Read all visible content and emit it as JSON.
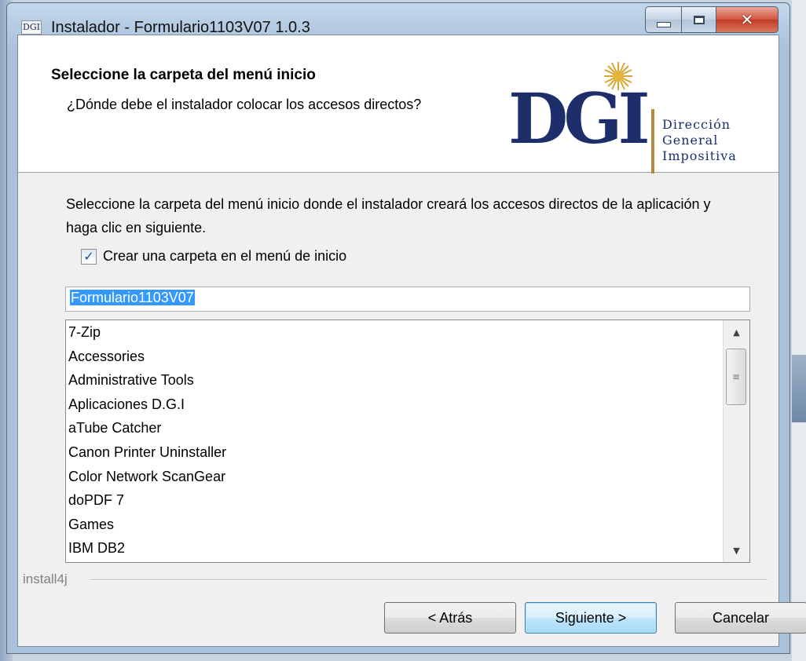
{
  "window": {
    "title": "Instalador - Formulario1103V07 1.0.3",
    "icon_text": "DGI"
  },
  "header": {
    "title": "Seleccione la carpeta del menú inicio",
    "subtitle": "¿Dónde debe el instalador colocar los accesos directos?"
  },
  "logo": {
    "mark": "DGI",
    "line1": "Dirección",
    "line2": "General",
    "line3": "Impositiva",
    "color": "#1d2e6b",
    "accent": "#b48a3c"
  },
  "instructions": "Seleccione la carpeta del menú inicio donde el instalador creará los accesos directos de la aplicación y haga clic en siguiente.",
  "checkbox": {
    "label": "Crear una carpeta en el menú de inicio",
    "checked": true
  },
  "folder_input": {
    "value": "Formulario1103V07"
  },
  "folders": [
    "7-Zip",
    "Accessories",
    "Administrative Tools",
    "Aplicaciones D.G.I",
    "aTube Catcher",
    "Canon Printer Uninstaller",
    "Color Network ScanGear",
    "doPDF 7",
    "Games",
    "IBM DB2"
  ],
  "brand": "install4j",
  "buttons": {
    "back": "< Atrás",
    "next": "Siguiente >",
    "cancel": "Cancelar"
  }
}
